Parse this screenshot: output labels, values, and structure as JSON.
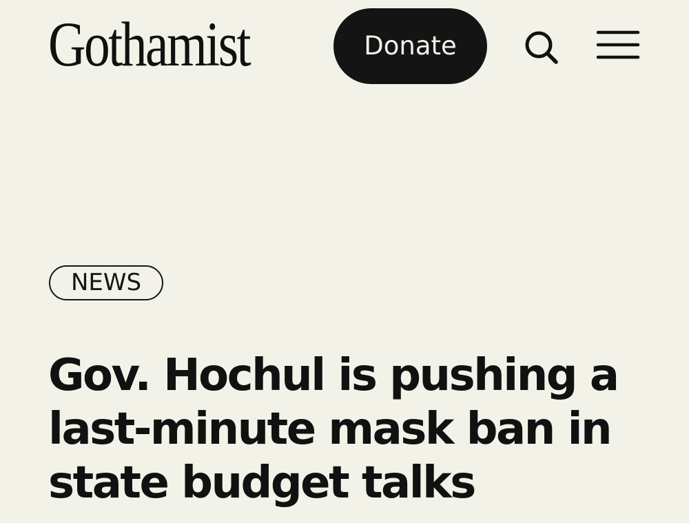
{
  "header": {
    "logo_text": "Gothamist",
    "donate_label": "Donate",
    "search_icon": "search-icon",
    "menu_icon": "hamburger-menu-icon"
  },
  "article": {
    "category": "NEWS",
    "headline": "Gov. Hochul is pushing a last-minute mask ban in state budget talks"
  },
  "colors": {
    "background": "#f3f2e8",
    "text": "#111111",
    "donate_bg": "#141414",
    "donate_text": "#f3f2e8"
  }
}
